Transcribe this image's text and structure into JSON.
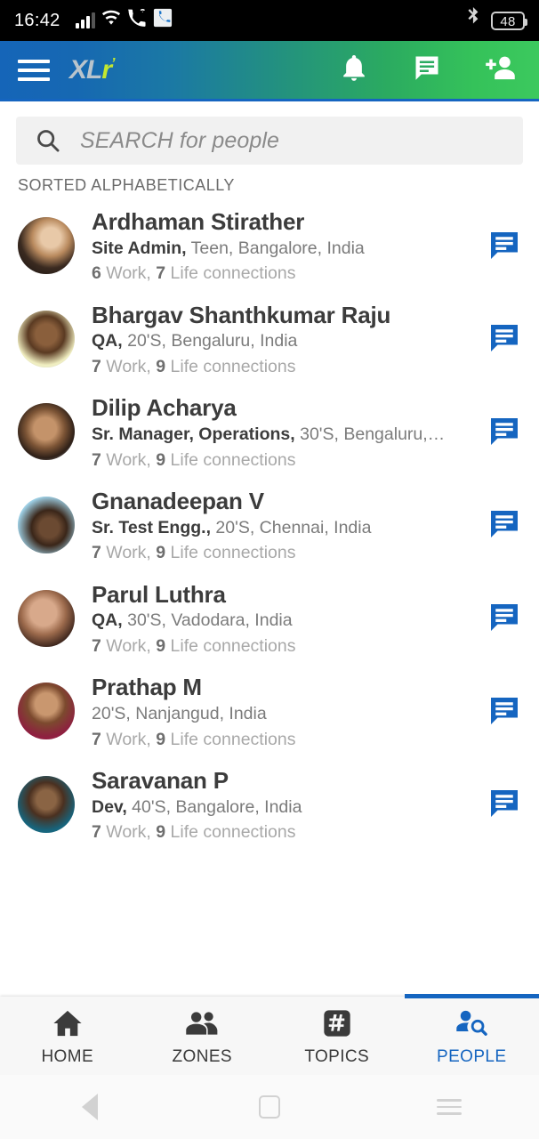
{
  "status_bar": {
    "time": "16:42",
    "battery": "48",
    "icons": [
      "signal-bars-icon",
      "wifi-icon",
      "wifi-calling-icon",
      "phone-badge-icon",
      "bluetooth-icon",
      "battery-icon"
    ]
  },
  "app_bar": {
    "menu_icon": "hamburger-menu-icon",
    "logo_primary": "XL",
    "logo_accent": "r",
    "logo_dot": "’",
    "actions": [
      {
        "name": "notifications-button",
        "icon": "bell-icon"
      },
      {
        "name": "messages-button",
        "icon": "chat-bubble-icon"
      },
      {
        "name": "add-person-button",
        "icon": "person-add-icon"
      }
    ]
  },
  "search": {
    "icon": "search-icon",
    "placeholder": "SEARCH for people",
    "value": ""
  },
  "list_header": "SORTED ALPHABETICALLY",
  "people": [
    {
      "name": "Ardhaman Stirather",
      "role": "Site Admin,",
      "meta": "Teen, Bangalore, India",
      "work": "6",
      "work_label": "Work,",
      "life": "7",
      "life_label": "Life connections",
      "chat_icon": "chat-bubble-icon"
    },
    {
      "name": "Bhargav Shanthkumar Raju",
      "role": "QA,",
      "meta": "20'S, Bengaluru, India",
      "work": "7",
      "work_label": "Work,",
      "life": "9",
      "life_label": "Life connections",
      "chat_icon": "chat-bubble-icon"
    },
    {
      "name": "Dilip Acharya",
      "role": "Sr. Manager, Operations,",
      "meta": "30'S, Bengaluru,…",
      "work": "7",
      "work_label": "Work,",
      "life": "9",
      "life_label": "Life connections",
      "chat_icon": "chat-bubble-icon"
    },
    {
      "name": "Gnanadeepan V",
      "role": "Sr. Test Engg.,",
      "meta": "20'S, Chennai, India",
      "work": "7",
      "work_label": "Work,",
      "life": "9",
      "life_label": "Life connections",
      "chat_icon": "chat-bubble-icon"
    },
    {
      "name": "Parul Luthra",
      "role": "QA,",
      "meta": "30'S, Vadodara, India",
      "work": "7",
      "work_label": "Work,",
      "life": "9",
      "life_label": "Life connections",
      "chat_icon": "chat-bubble-icon"
    },
    {
      "name": "Prathap M",
      "role": "",
      "meta": "20'S, Nanjangud, India",
      "work": "7",
      "work_label": "Work,",
      "life": "9",
      "life_label": "Life connections",
      "chat_icon": "chat-bubble-icon"
    },
    {
      "name": "Saravanan P",
      "role": "Dev,",
      "meta": "40'S, Bangalore, India",
      "work": "7",
      "work_label": "Work,",
      "life": "9",
      "life_label": "Life connections",
      "chat_icon": "chat-bubble-icon"
    }
  ],
  "bottom_nav": {
    "active": "PEOPLE",
    "items": [
      {
        "label": "HOME",
        "icon": "home-icon",
        "active": false
      },
      {
        "label": "ZONES",
        "icon": "people-group-icon",
        "active": false
      },
      {
        "label": "TOPICS",
        "icon": "hashtag-icon",
        "active": false
      },
      {
        "label": "PEOPLE",
        "icon": "person-search-icon",
        "active": true
      }
    ]
  },
  "android_nav": {
    "back": "back-triangle-icon",
    "home": "home-square-icon",
    "recents": "recents-icon"
  },
  "colors": {
    "accent_blue": "#1565c0",
    "header_start": "#1565b8",
    "header_end": "#3cc95e",
    "logo_accent": "#c3e830",
    "search_bg": "#f1f1f1"
  }
}
